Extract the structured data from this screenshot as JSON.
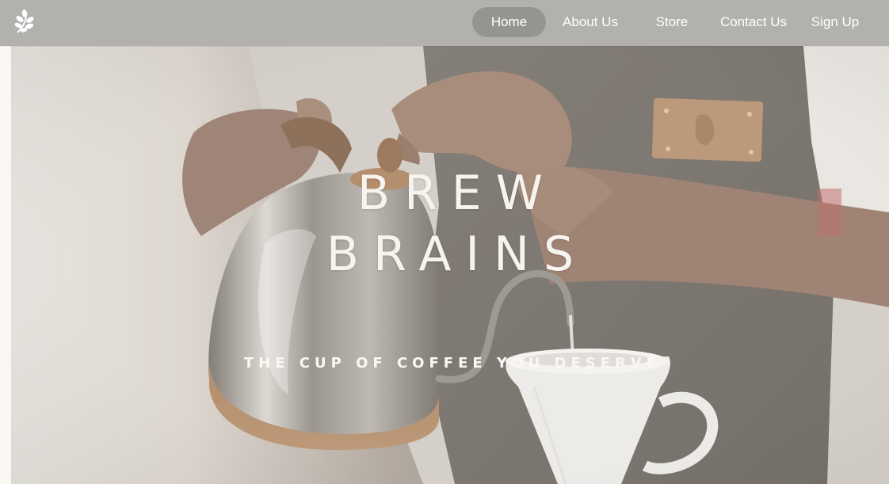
{
  "nav": {
    "logo_icon": "leaf-sprig-icon",
    "links": [
      {
        "label": "Home",
        "active": true
      },
      {
        "label": "About Us",
        "active": false
      },
      {
        "label": "Store",
        "active": false
      },
      {
        "label": "Contact Us",
        "active": false
      },
      {
        "label": "Sign Up",
        "active": false
      }
    ]
  },
  "hero": {
    "title_line_1": "BREW",
    "title_line_2": "BRAINS",
    "tagline": "THE CUP OF COFFEE YOU DESERVE",
    "image_subject": "barista pouring water from a gooseneck kettle into a white pour-over dripper"
  },
  "colors": {
    "navbar": "#b2b1ae",
    "active_pill": "#959491",
    "nav_text": "#ffffff",
    "hero_text": "#f7f3ef",
    "page_bg": "#fbf8f4"
  }
}
